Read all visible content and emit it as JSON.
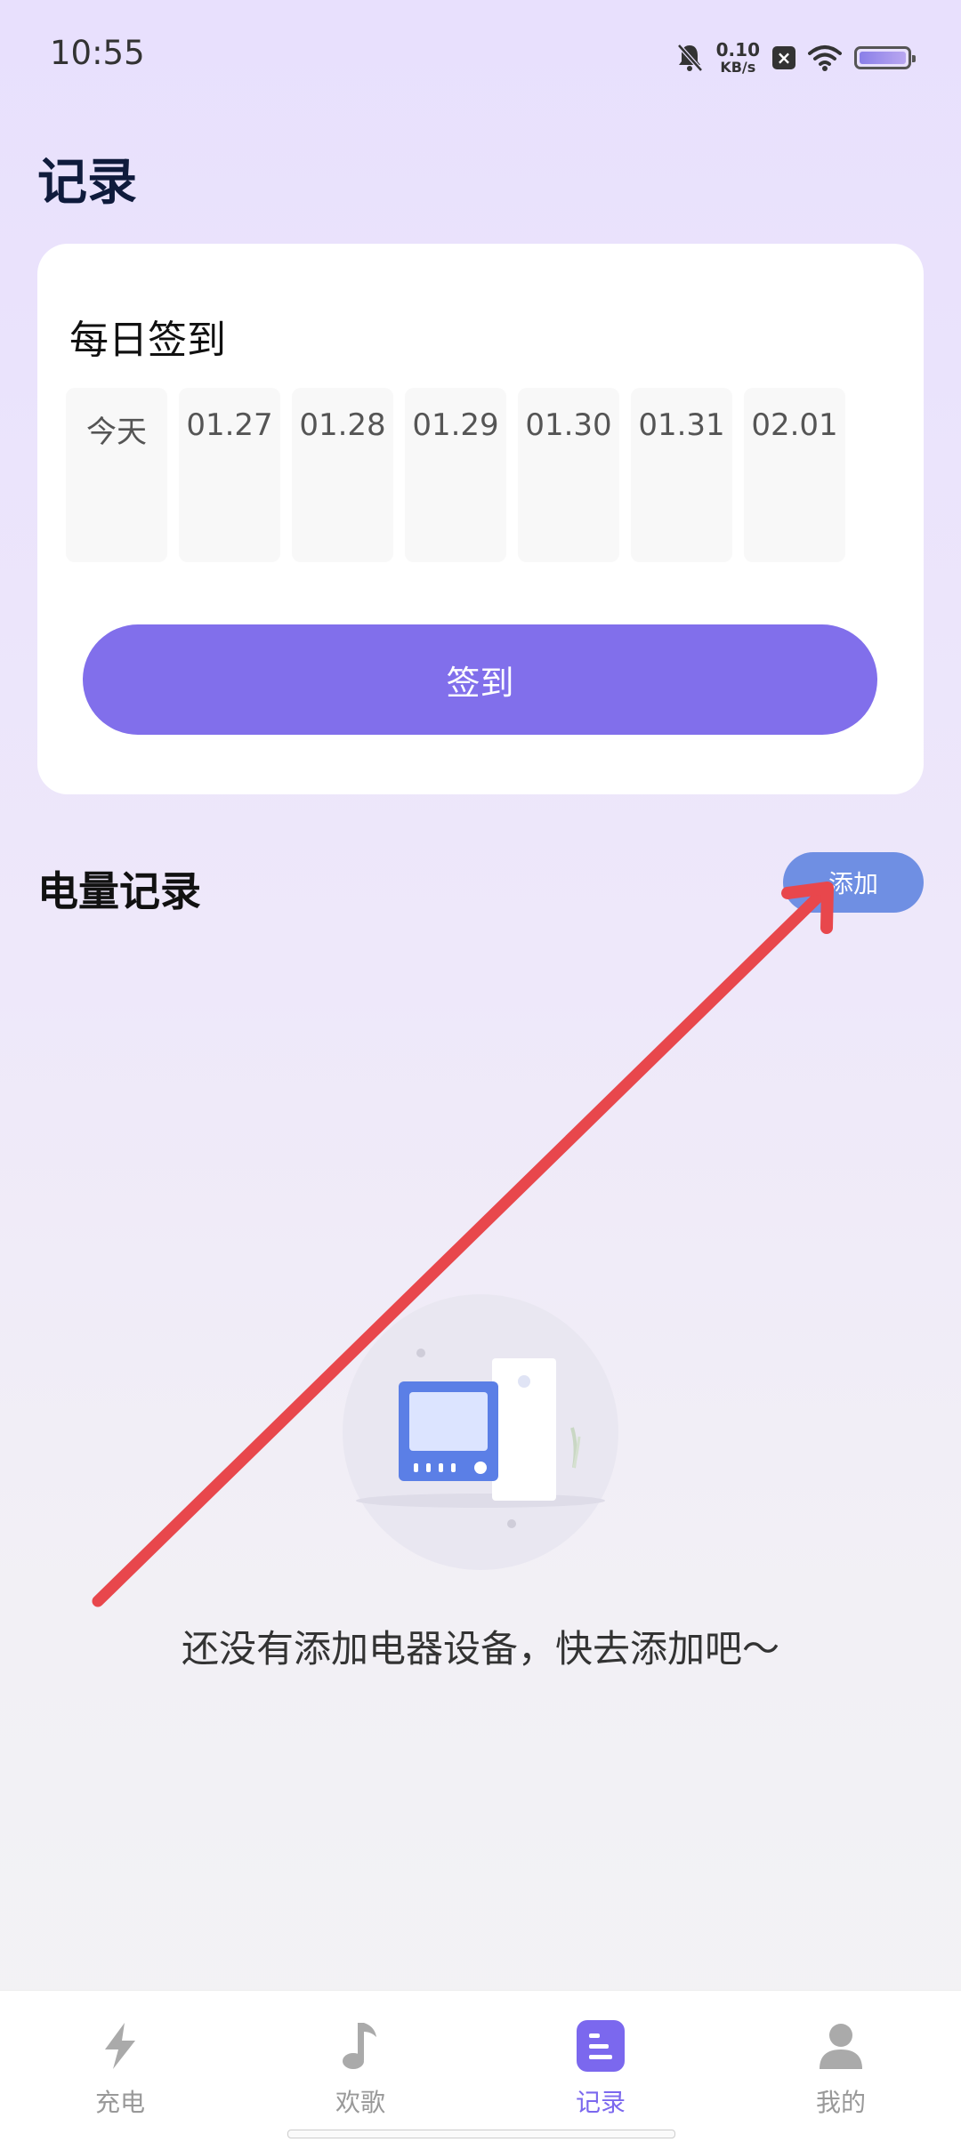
{
  "status_bar": {
    "time": "10:55",
    "net_speed_value": "0.10",
    "net_speed_unit": "KB/s",
    "icons": [
      "mute-bell-icon",
      "close-box-icon",
      "wifi-icon",
      "battery-icon"
    ]
  },
  "page_title": "记录",
  "signin_card": {
    "title": "每日签到",
    "days": [
      "今天",
      "01.27",
      "01.28",
      "01.29",
      "01.30",
      "01.31",
      "02.01"
    ],
    "button_label": "签到"
  },
  "power_record": {
    "title": "电量记录",
    "add_label": "添加",
    "empty_text": "还没有添加电器设备，快去添加吧～"
  },
  "bottom_nav": {
    "items": [
      {
        "label": "充电",
        "icon": "lightning-icon"
      },
      {
        "label": "欢歌",
        "icon": "music-note-icon"
      },
      {
        "label": "记录",
        "icon": "record-list-icon",
        "active": true
      },
      {
        "label": "我的",
        "icon": "person-icon"
      }
    ]
  },
  "colors": {
    "accent": "#816FEB",
    "add_button": "#6F8FE3",
    "annotation_arrow": "#E8474C",
    "nav_active": "#7B68EE"
  }
}
